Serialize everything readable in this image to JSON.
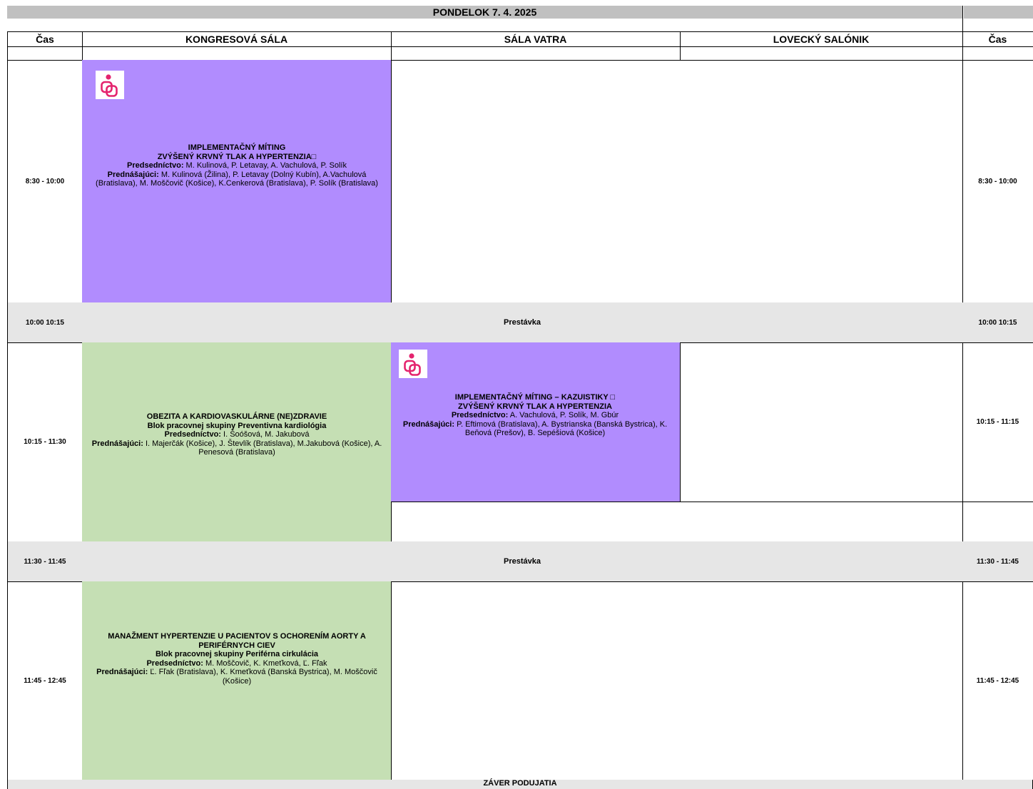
{
  "header": {
    "title": "PONDELOK 7. 4. 2025",
    "columns": [
      "Čas",
      "KONGRESOVÁ SÁLA",
      "SÁLA VATRA",
      "LOVECKÝ SALÓNIK",
      "Čas"
    ]
  },
  "times": {
    "t1": "8:30 - 10:00",
    "t2": "10:00 10:15",
    "t3": "10:15 - 11:30",
    "t3_right": "10:15 - 11:15",
    "t4": "11:30 - 11:45",
    "t5": "11:45 - 12:45"
  },
  "breaks": {
    "b1": "Prestávka",
    "b2": "Prestávka"
  },
  "sessions": {
    "s1": {
      "title1": "IMPLEMENTAČNÝ MÍTING",
      "title2": "ZVÝŠENÝ KRVNÝ TLAK A HYPERTENZIA□",
      "chair_label": "Predsedníctvo:",
      "chair": "M. Kulinová, P. Letavay, A. Vachulová, P. Solík",
      "speakers_label": "Prednášajúci:",
      "speakers": "M. Kulinová (Žilina), P. Letavay (Dolný Kubín), A.Vachulová (Bratislava), M. Moščovič (Košice), K.Cenkerová (Bratislava), P. Solík (Bratislava)"
    },
    "s2": {
      "title1": "OBEZITA A KARDIOVASKULÁRNE (NE)ZDRAVIE",
      "title2": "Blok pracovnej skupiny Preventivna kardiológia",
      "chair_label": "Predsedníctvo:",
      "chair": "I. Šoóšová, M. Jakubová",
      "speakers_label": "Prednášajúci:",
      "speakers": "I. Majerčák (Košice), J. Števlík (Bratislava), M.Jakubová (Košice), A. Penesová (Bratislava)"
    },
    "s3": {
      "title1": "IMPLEMENTAČNÝ MÍTING – KAZUISTIKY □",
      "title2": "ZVÝŠENÝ KRVNÝ TLAK A HYPERTENZIA",
      "chair_label": "Predsedníctvo:",
      "chair": "A. Vachulová, P. Solík, M. Gbúr",
      "speakers_label": "Prednášajúci:",
      "speakers": "P. Eftimová (Bratislava), A. Bystrianska (Banská Bystrica), K. Beňová (Prešov), B. Sepéšiová (Košice)"
    },
    "s4": {
      "title1": "MANAŽMENT HYPERTENZIE U PACIENTOV S OCHORENÍM AORTY A PERIFÉRNYCH CIEV",
      "title2": "Blok pracovnej skupiny Periférna cirkulácia",
      "chair_label": "Predsedníctvo:",
      "chair": "M. Moščovič, K. Kmeťková, Ľ. Fľak",
      "speakers_label": "Prednášajúci:",
      "speakers": "Ľ. Fľak (Bratislava), K. Kmeťková (Banská Bystrica), M. Moščovič (Košice)"
    }
  },
  "footer": {
    "text": "ZÁVER  PODUJATIA"
  },
  "colors": {
    "purple_session": "#b18cfe",
    "green_session": "#c5dfb4",
    "break_gray": "#e6e6e6",
    "title_bar_gray": "#c0c0c0",
    "logo_pink": "#e4246e"
  },
  "icons": {
    "session_logo": "hypertension-society-logo"
  }
}
